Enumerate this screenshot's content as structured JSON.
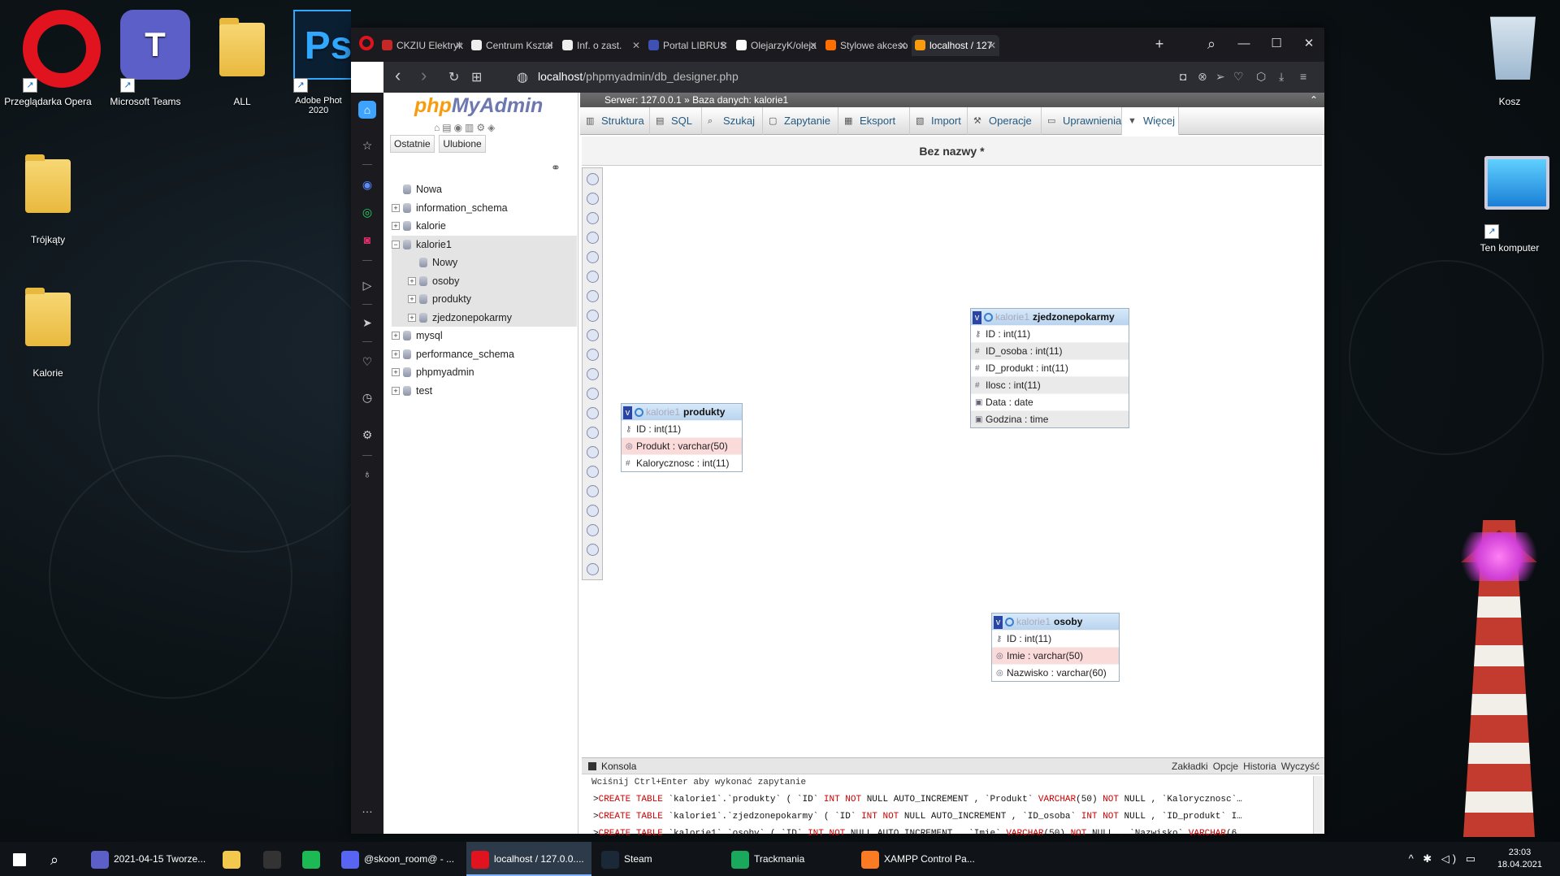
{
  "desktop": {
    "icons": [
      {
        "label": "Przeglądarka Opera"
      },
      {
        "label": "Microsoft Teams"
      },
      {
        "label": "ALL"
      },
      {
        "label": "Adobe Phot\n2020"
      },
      {
        "label": "Trójkąty"
      },
      {
        "label": "Kalorie"
      },
      {
        "label": "Kosz"
      },
      {
        "label": "Ten komputer"
      }
    ],
    "icon_glyphs": {
      "teams": "T",
      "ps": "Ps"
    }
  },
  "browser": {
    "tabs": [
      {
        "label": "CKZIU Elektryk",
        "icon": "ckziu-icon",
        "color": "#c62828"
      },
      {
        "label": "Centrum Kształ",
        "icon": "page-icon",
        "color": "#eeeeee"
      },
      {
        "label": "Inf. o zast.",
        "icon": "page-icon",
        "color": "#eeeeee"
      },
      {
        "label": "Portal LIBRUS",
        "icon": "librus-icon",
        "color": "#3f51b5"
      },
      {
        "label": "OlejarzyK/oleja",
        "icon": "github-icon",
        "color": "#ffffff"
      },
      {
        "label": "Stylowe akceso",
        "icon": "shop-icon",
        "color": "#ff6f00"
      },
      {
        "label": "localhost / 127",
        "icon": "phpmyadmin-icon",
        "color": "#f89c0e"
      }
    ],
    "url_prefix": "localhost",
    "url_path": "/phpmyadmin/db_designer.php",
    "glyphs": {
      "close": "✕",
      "new_tab": "+",
      "search": "⌕",
      "minimize": "—",
      "maximize": "☐",
      "back": "‹",
      "forward": "›",
      "reload": "↻",
      "grid": "⊞",
      "site": "◍",
      "camera": "◘",
      "shield": "⊗",
      "send": "➢",
      "heart": "♡",
      "box": "⬡",
      "download": "⤓",
      "menu": "≡"
    }
  },
  "sidebar_glyphs": {
    "home": "⌂",
    "star": "☆",
    "messenger": "◉",
    "whatsapp": "◎",
    "instagram": "◙",
    "play": "▷",
    "send": "➤",
    "heart": "♡",
    "clock": "◷",
    "settings": "⚙",
    "bulb": "♁",
    "more": "…"
  },
  "pma": {
    "logo_php": "php",
    "logo_admin": "MyAdmin",
    "nav_icons": "⌂▤◉▥⚙◈",
    "nav_tabs": [
      "Ostatnie",
      "Ulubione"
    ],
    "link_icon": "⚭",
    "tree_glyphs": {
      "plus": "+",
      "minus": "−"
    },
    "tree": [
      {
        "label": "Nowa",
        "level": 0,
        "pm": ""
      },
      {
        "label": "information_schema",
        "level": 0,
        "pm": "+"
      },
      {
        "label": "kalorie",
        "level": 0,
        "pm": "+"
      },
      {
        "label": "kalorie1",
        "level": 0,
        "pm": "−",
        "selected": true
      },
      {
        "label": "Nowy",
        "level": 1,
        "pm": "",
        "selected": true
      },
      {
        "label": "osoby",
        "level": 1,
        "pm": "+",
        "selected": true
      },
      {
        "label": "produkty",
        "level": 1,
        "pm": "+",
        "selected": true
      },
      {
        "label": "zjedzonepokarmy",
        "level": 1,
        "pm": "+",
        "selected": true
      },
      {
        "label": "mysql",
        "level": 0,
        "pm": "+"
      },
      {
        "label": "performance_schema",
        "level": 0,
        "pm": "+"
      },
      {
        "label": "phpmyadmin",
        "level": 0,
        "pm": "+"
      },
      {
        "label": "test",
        "level": 0,
        "pm": "+"
      }
    ],
    "breadcrumb": {
      "server": "Serwer: 127.0.0.1",
      "sep": "»",
      "database": "Baza danych: kalorie1"
    },
    "collapse_glyph": "⌃",
    "menu": [
      {
        "label": "Struktura",
        "icon": "structure-icon",
        "glyph": "▥"
      },
      {
        "label": "SQL",
        "icon": "sql-icon",
        "glyph": "▤"
      },
      {
        "label": "Szukaj",
        "icon": "search-icon",
        "glyph": "⌕"
      },
      {
        "label": "Zapytanie",
        "icon": "query-icon",
        "glyph": "▢"
      },
      {
        "label": "Eksport",
        "icon": "export-icon",
        "glyph": "▦"
      },
      {
        "label": "Import",
        "icon": "import-icon",
        "glyph": "▧"
      },
      {
        "label": "Operacje",
        "icon": "wrench-icon",
        "glyph": "⚒"
      },
      {
        "label": "Uprawnienia",
        "icon": "privileges-icon",
        "glyph": "▭"
      },
      {
        "label": "Więcej",
        "icon": "more-icon",
        "glyph": "▼"
      }
    ],
    "designer_title": "Bez nazwy *",
    "tables": [
      {
        "db": "kalorie1",
        "name": "zjedzonepokarmy",
        "id": "zjedzonepokarmy",
        "columns": [
          "ID : int(11)",
          "ID_osoba : int(11)",
          "ID_produkt : int(11)",
          "Ilosc : int(11)",
          "Data : date",
          "Godzina : time"
        ],
        "kinds": [
          "key",
          "num",
          "num",
          "num",
          "date",
          "date"
        ]
      },
      {
        "db": "kalorie1",
        "name": "produkty",
        "id": "produkty",
        "columns": [
          "ID : int(11)",
          "Produkt : varchar(50)",
          "Kalorycznosc : int(11)"
        ],
        "kinds": [
          "key",
          "text",
          "num"
        ]
      },
      {
        "db": "kalorie1",
        "name": "osoby",
        "id": "osoby",
        "columns": [
          "ID : int(11)",
          "Imie : varchar(50)",
          "Nazwisko : varchar(60)"
        ],
        "kinds": [
          "key",
          "text",
          "text"
        ]
      }
    ],
    "table_glyphs": {
      "toggle": "v",
      "key": "⚷",
      "num": "#",
      "date": "▣",
      "text": "◎"
    },
    "console": {
      "label": "Konsola",
      "links": [
        "Zakładki",
        "Opcje",
        "Historia",
        "Wyczyść"
      ],
      "hint": "Wciśnij Ctrl+Enter aby wykonać zapytanie",
      "prompt": ">",
      "lines": [
        [
          [
            "kw",
            "CREATE TABLE "
          ],
          [
            "q",
            "`kalorie1`.`produkty` ( `ID` "
          ],
          [
            "kw",
            "INT NOT "
          ],
          [
            "q",
            "NULL AUTO_INCREMENT , `Produkt` "
          ],
          [
            "kw",
            "VARCHAR"
          ],
          [
            "q",
            "(50) "
          ],
          [
            "kw",
            "NOT "
          ],
          [
            "q",
            "NULL , `Kalorycznosc`…"
          ]
        ],
        [
          [
            "kw",
            "CREATE TABLE "
          ],
          [
            "q",
            "`kalorie1`.`zjedzonepokarmy` ( `ID` "
          ],
          [
            "kw",
            "INT NOT "
          ],
          [
            "q",
            "NULL AUTO_INCREMENT , `ID_osoba` "
          ],
          [
            "kw",
            "INT NOT "
          ],
          [
            "q",
            "NULL , `ID_produkt` I…"
          ]
        ],
        [
          [
            "kw",
            "CREATE TABLE "
          ],
          [
            "q",
            "`kalorie1`.`osoby` ( `ID` "
          ],
          [
            "kw",
            "INT NOT "
          ],
          [
            "q",
            "NULL AUTO_INCREMENT , `Imie` "
          ],
          [
            "kw",
            "VARCHAR"
          ],
          [
            "q",
            "(50) "
          ],
          [
            "kw",
            "NOT "
          ],
          [
            "q",
            "NULL , `Nazwisko` "
          ],
          [
            "kw",
            "VARCHAR"
          ],
          [
            "q",
            "(6…"
          ]
        ]
      ]
    }
  },
  "taskbar": {
    "items": [
      {
        "label": "",
        "icon": "windows-icon",
        "color": "#ffffff"
      },
      {
        "label": "",
        "icon": "search-icon",
        "color": "#101317"
      },
      {
        "label": "2021-04-15 Tworze...",
        "icon": "teams-icon",
        "color": "#5b5fc7"
      },
      {
        "label": "",
        "icon": "folder-icon",
        "color": "#f2c94c"
      },
      {
        "label": "",
        "icon": "epic-icon",
        "color": "#333333"
      },
      {
        "label": "",
        "icon": "spotify-icon",
        "color": "#1db954"
      },
      {
        "label": "@skoon_room@ - ...",
        "icon": "discord-icon",
        "color": "#5865f2"
      },
      {
        "label": "localhost / 127.0.0....",
        "icon": "opera-icon",
        "color": "#e0131e",
        "active": true
      },
      {
        "label": "Steam",
        "icon": "steam-icon",
        "color": "#1b2838"
      },
      {
        "label": "Trackmania",
        "icon": "trackmania-icon",
        "color": "#1aa85c"
      },
      {
        "label": "XAMPP Control Pa...",
        "icon": "xampp-icon",
        "color": "#fb7a24"
      }
    ],
    "search_glyph": "⌕",
    "tray": "^ ✱ ◁) ▭",
    "time": "23:03",
    "date": "18.04.2021"
  }
}
